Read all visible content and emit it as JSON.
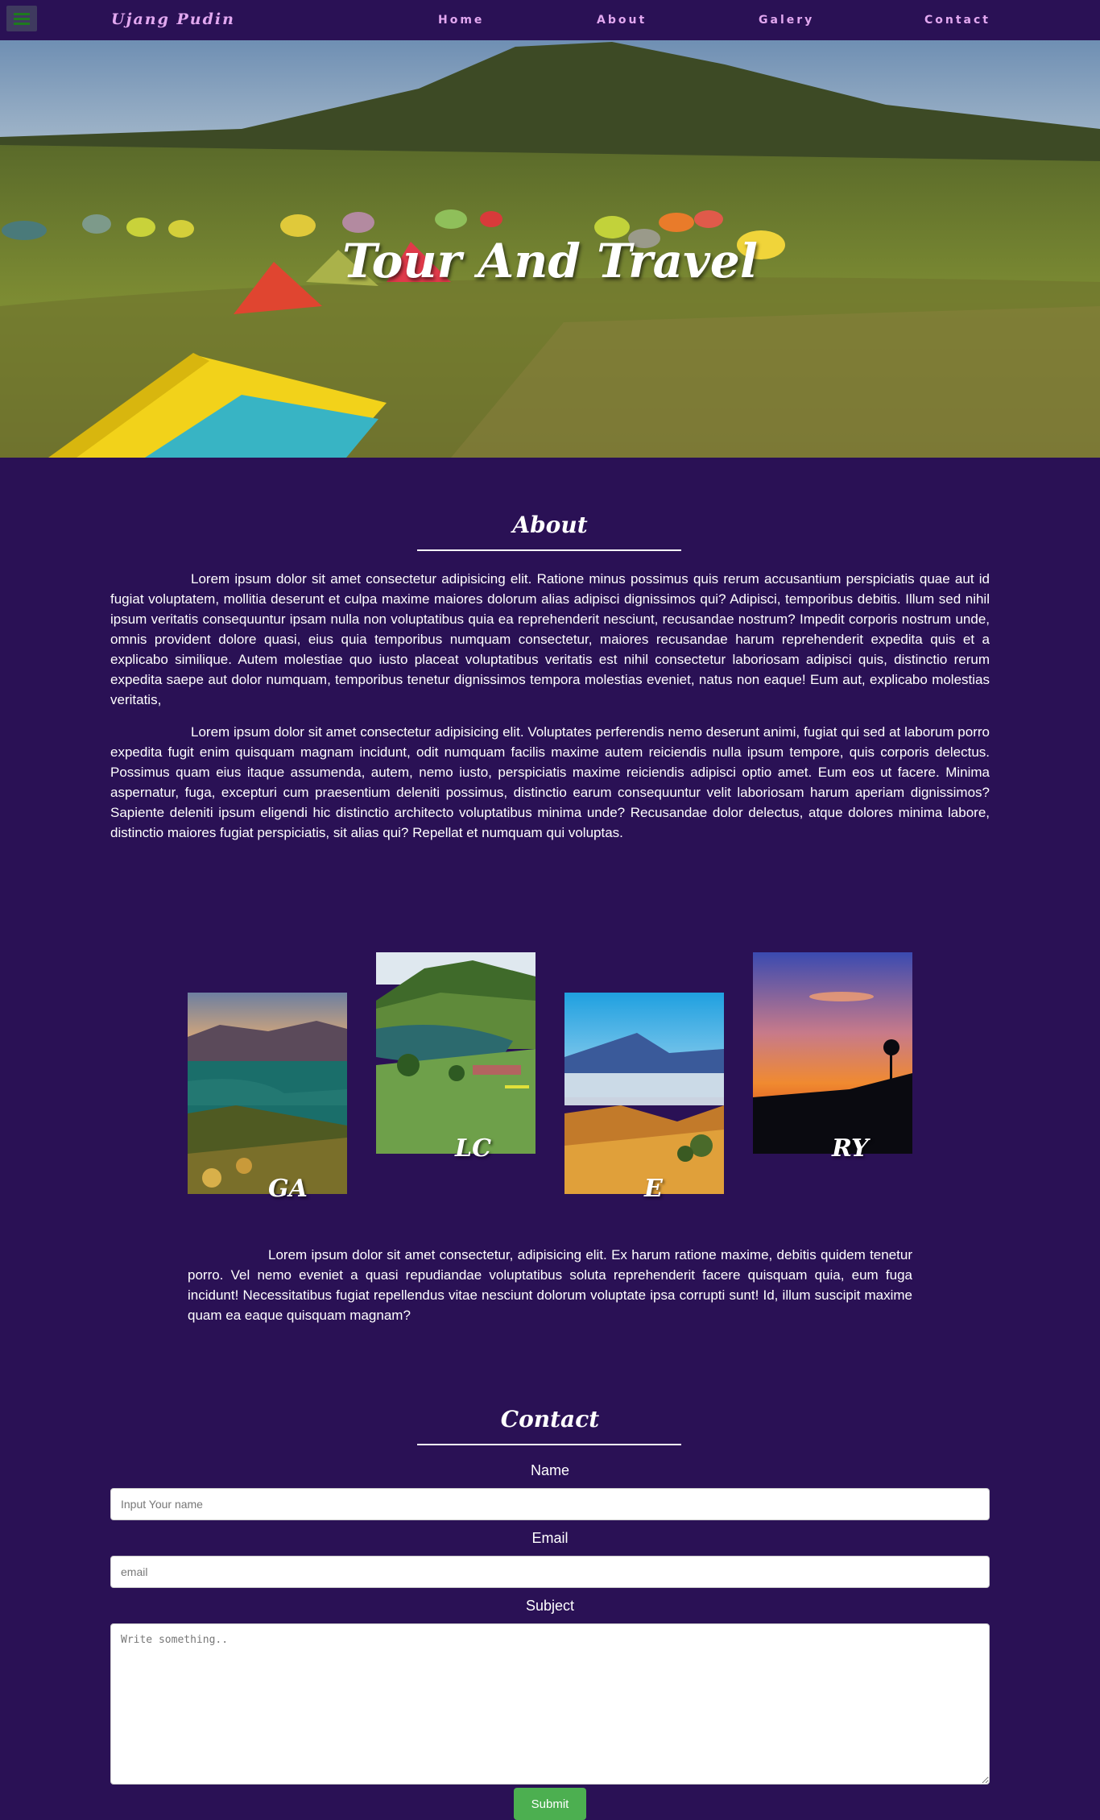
{
  "navbar": {
    "brand": "Ujang Pudin",
    "links": [
      {
        "label": "Home"
      },
      {
        "label": "About"
      },
      {
        "label": "Galery"
      },
      {
        "label": "Contact"
      }
    ]
  },
  "hero": {
    "title": "Tour And Travel"
  },
  "about": {
    "title": "About",
    "paragraphs": [
      "Lorem ipsum dolor sit amet consectetur adipisicing elit. Ratione minus possimus quis rerum accusantium perspiciatis quae aut id fugiat voluptatem, mollitia deserunt et culpa maxime maiores dolorum alias adipisci dignissimos qui? Adipisci, temporibus debitis. Illum sed nihil ipsum veritatis consequuntur ipsam nulla non voluptatibus quia ea reprehenderit nesciunt, recusandae nostrum? Impedit corporis nostrum unde, omnis provident dolore quasi, eius quia temporibus numquam consectetur, maiores recusandae harum reprehenderit expedita quis et a explicabo similique. Autem molestiae quo iusto placeat voluptatibus veritatis est nihil consectetur laboriosam adipisci quis, distinctio rerum expedita saepe aut dolor numquam, temporibus tenetur dignissimos tempora molestias eveniet, natus non eaque! Eum aut, explicabo molestias veritatis,",
      "Lorem ipsum dolor sit amet consectetur adipisicing elit. Voluptates perferendis nemo deserunt animi, fugiat qui sed at laborum porro expedita fugit enim quisquam magnam incidunt, odit numquam facilis maxime autem reiciendis nulla ipsum tempore, quis corporis delectus. Possimus quam eius itaque assumenda, autem, nemo iusto, perspiciatis maxime reiciendis adipisci optio amet. Eum eos ut facere. Minima aspernatur, fuga, excepturi cum praesentium deleniti possimus, distinctio earum consequuntur velit laboriosam harum aperiam dignissimos? Sapiente deleniti ipsum eligendi hic distinctio architecto voluptatibus minima unde? Recusandae dolor delectus, atque dolores minima labore, distinctio maiores fugiat perspiciatis, sit alias qui? Repellat et numquam qui voluptas."
    ]
  },
  "gallery": {
    "items": [
      {
        "label": "GA"
      },
      {
        "label": "LC"
      },
      {
        "label": "E"
      },
      {
        "label": "RY"
      }
    ],
    "caption": "Lorem ipsum dolor sit amet consectetur, adipisicing elit. Ex harum ratione maxime, debitis quidem tenetur porro. Vel nemo eveniet a quasi repudiandae voluptatibus soluta reprehenderit facere quisquam quia, eum fuga incidunt! Necessitatibus fugiat repellendus vitae nesciunt dolorum voluptate ipsa corrupti sunt! Id, illum suscipit maxime quam ea eaque quisquam magnam?"
  },
  "contact": {
    "title": "Contact",
    "name_label": "Name",
    "name_placeholder": "Input Your name",
    "email_label": "Email",
    "email_placeholder": "email",
    "subject_label": "Subject",
    "subject_placeholder": "Write something..",
    "submit_label": "Submit"
  },
  "colors": {
    "background": "#2a1155",
    "nav_text": "#e2a8f0",
    "submit": "#4caf50"
  },
  "icons": {
    "menu": "hamburger-menu-icon"
  }
}
